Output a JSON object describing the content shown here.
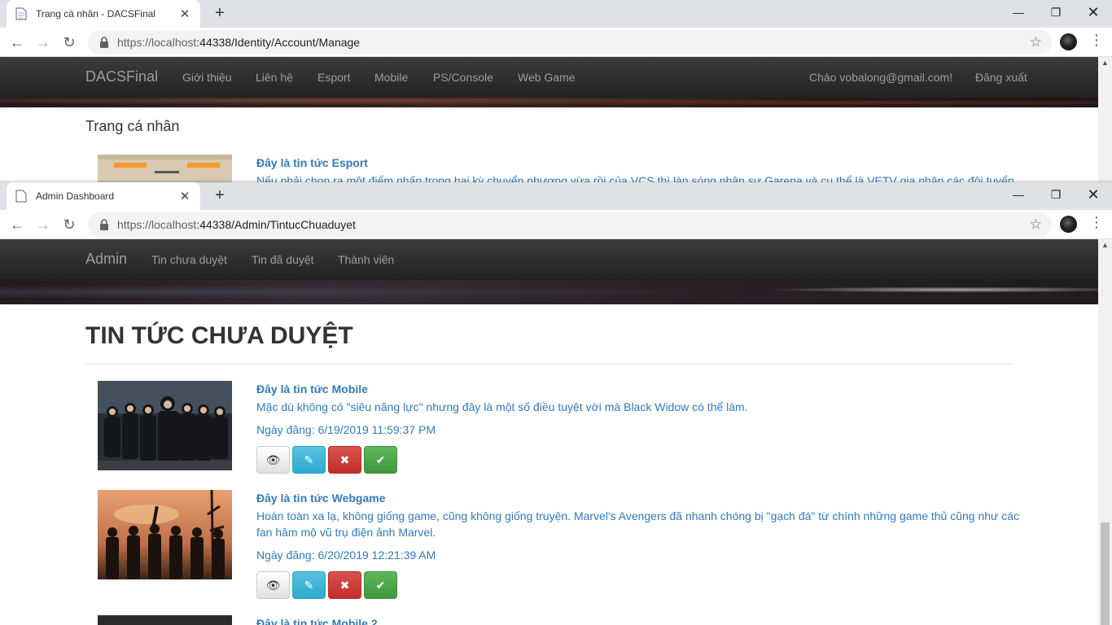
{
  "window1": {
    "tab_title": "Trang cá nhân - DACSFinal",
    "url_host": "https://localhost",
    "url_path": ":44338/Identity/Account/Manage",
    "nav": {
      "brand": "DACSFinal",
      "links": [
        "Giới thiệu",
        "Liên hệ",
        "Esport",
        "Mobile",
        "PS/Console",
        "Web Game"
      ],
      "greeting": "Chào vobalong@gmail.com!",
      "logout": "Đăng xuất"
    },
    "page_title": "Trang cá nhân",
    "article": {
      "title": "Đây là tin tức Esport",
      "description": "Nếu phải chọn ra một điểm nhấn trong hai kỳ chuyển nhượng vừa rồi của VCS thì làn sóng nhân sự Garena và cụ thể là VETV gia nhập các đội tuyển"
    }
  },
  "window2": {
    "tab_title": "Admin Dashboard",
    "url_host": "https://localhost",
    "url_path": ":44338/Admin/TintucChuaduyet",
    "nav": {
      "brand": "Admin",
      "links": [
        "Tin chưa duyệt",
        "Tin đã duyệt",
        "Thành viên"
      ]
    },
    "page_title": "TIN TỨC CHƯA DUYỆT",
    "articles": [
      {
        "title": "Đây là tin tức Mobile",
        "description": "Mặc dù không có \"siêu năng lực\" nhưng đây là một số điều tuyệt vời mà Black Widow có thể làm.",
        "date": "Ngày đăng: 6/19/2019 11:59:37 PM"
      },
      {
        "title": "Đây là tin tức Webgame",
        "description": "Hoàn toàn xa lạ, không giống game, cũng không giống truyện. Marvel's Avengers đã nhanh chóng bị \"gạch đá\" từ chính những game thủ cũng như các fan hâm mộ vũ trụ điện ảnh Marvel.",
        "date": "Ngày đăng: 6/20/2019 12:21:39 AM"
      },
      {
        "title": "Đây là tin tức Mobile 2"
      }
    ]
  },
  "icons": {
    "close": "✕",
    "new_tab": "+",
    "minimize": "—",
    "maximize": "❐",
    "window_close": "✕",
    "back": "←",
    "forward": "→",
    "reload": "↻",
    "star": "☆",
    "menu": "⋮",
    "view": "👁",
    "edit": "✎",
    "delete": "✖",
    "approve": "✔",
    "scroll_up": "▲"
  },
  "colors": {
    "link": "#337ab7",
    "navbar": "#222222",
    "info": "#5bc0de",
    "danger": "#d9534f",
    "success": "#5cb85c"
  }
}
